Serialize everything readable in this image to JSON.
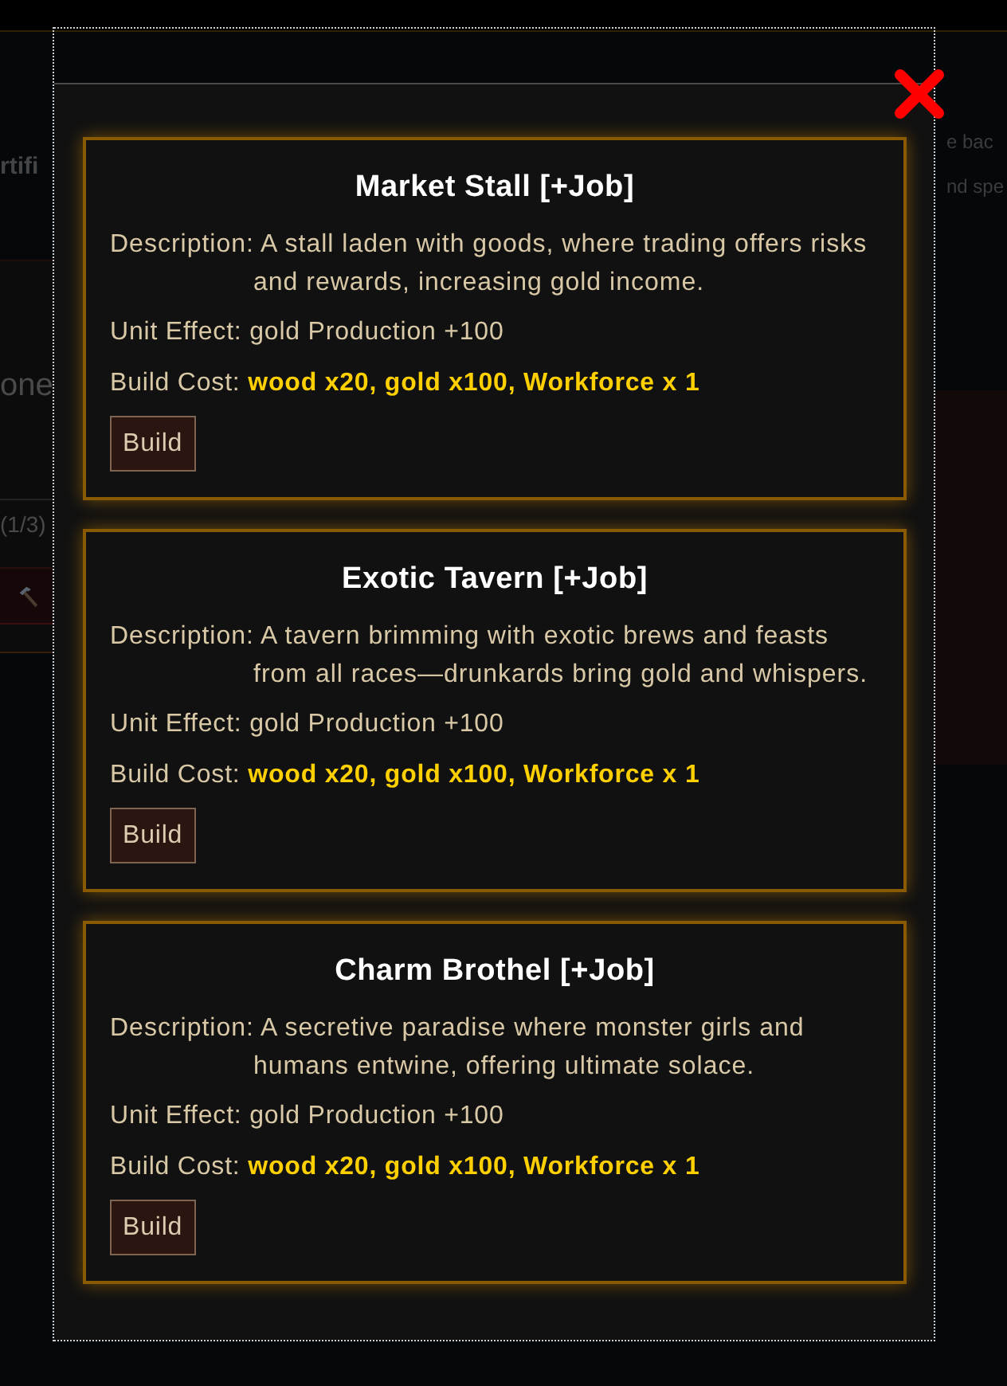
{
  "background": {
    "left_column": {
      "heading": "rtifi",
      "value": "one",
      "counter": "(1/3)"
    },
    "right_column": {
      "lines": [
        "e bac",
        "nd spe"
      ]
    }
  },
  "modal": {
    "buildings": [
      {
        "title": "Market Stall [+Job]",
        "description": "Description: A stall laden with goods, where trading offers risks and rewards, increasing gold income.",
        "effect": "Unit Effect: gold Production +100",
        "cost": "Build Cost: **wood x20, gold x100, Workforce x 1**",
        "button": "Build"
      },
      {
        "title": "Exotic Tavern [+Job]",
        "description": "Description: A tavern brimming with exotic brews and feasts from all races—drunkards bring gold and whispers.",
        "effect": "Unit Effect: gold Production +100",
        "cost": "Build Cost: **wood x20, gold x100, Workforce x 1**",
        "button": "Build"
      },
      {
        "title": "Charm Brothel [+Job]",
        "description": "Description: A secretive paradise where monster girls and humans entwine, offering ultimate solace.",
        "effect": "Unit Effect: gold Production +100",
        "cost": "Build Cost: **wood x20, gold x100, Workforce x 1**",
        "button": "Build"
      }
    ]
  }
}
